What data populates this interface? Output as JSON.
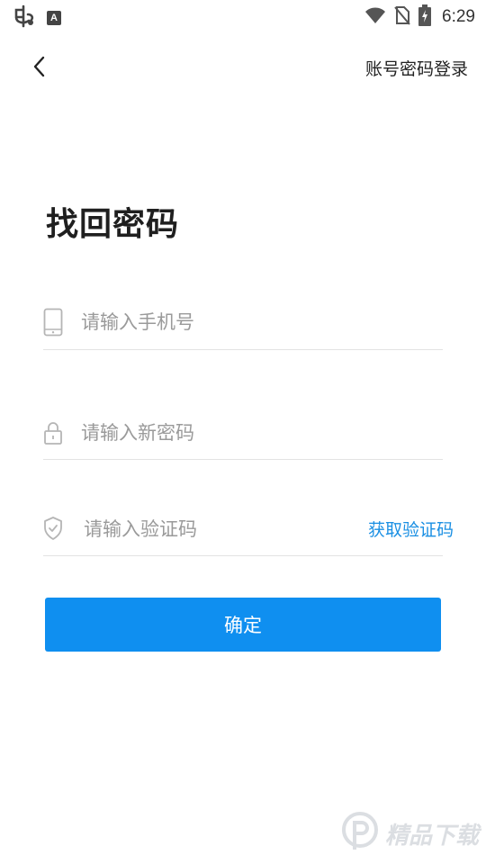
{
  "status_bar": {
    "time": "6:29",
    "left_icons": [
      "bug-icon",
      "a-box-icon"
    ],
    "a_box_text": "A",
    "right_icons": [
      "wifi-icon",
      "no-sim-icon",
      "battery-charging-icon"
    ]
  },
  "header": {
    "back_icon": "chevron-left-icon",
    "account_login_link": "账号密码登录"
  },
  "page": {
    "title": "找回密码"
  },
  "form": {
    "phone": {
      "icon": "phone-icon",
      "placeholder": "请输入手机号",
      "value": ""
    },
    "new_password": {
      "icon": "lock-icon",
      "placeholder": "请输入新密码",
      "value": ""
    },
    "verification_code": {
      "icon": "shield-check-icon",
      "placeholder": "请输入验证码",
      "value": "",
      "get_code_label": "获取验证码"
    },
    "confirm_label": "确定"
  },
  "watermark": {
    "icon": "p-logo-icon",
    "text": "精品下载"
  },
  "colors": {
    "accent": "#0f8ff0",
    "link": "#1a8fe3",
    "divider": "#e3e3e3",
    "placeholder": "#9a9a9a",
    "title": "#1f1f1f"
  }
}
